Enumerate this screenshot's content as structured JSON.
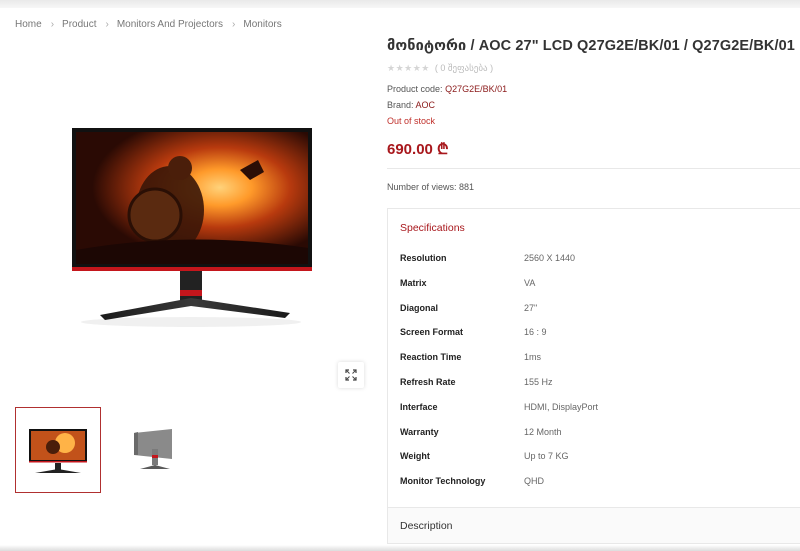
{
  "breadcrumb": [
    "Home",
    "Product",
    "Monitors And Projectors",
    "Monitors"
  ],
  "product": {
    "title": "მონიტორი / AOC 27\" LCD Q27G2E/BK/01 / Q27G2E/BK/01",
    "rating_stars": "★★★★★",
    "rating_text": "( 0 შეფასება )",
    "code_label": "Product code:",
    "code_value": "Q27G2E/BK/01",
    "brand_label": "Brand:",
    "brand_value": "AOC",
    "stock_status": "Out of stock",
    "price": "690.00 ₾",
    "views_label": "Number of views:",
    "views_value": "881"
  },
  "gallery": {
    "main_image": "aoc-monitor-front",
    "thumbnails": [
      "aoc-monitor-front",
      "aoc-monitor-back"
    ],
    "zoom_icon": "expand-icon"
  },
  "specifications": {
    "title": "Specifications",
    "rows": [
      {
        "name": "Resolution",
        "value": "2560 X 1440"
      },
      {
        "name": "Matrix",
        "value": "VA"
      },
      {
        "name": "Diagonal",
        "value": "27\""
      },
      {
        "name": "Screen Format",
        "value": "16 : 9"
      },
      {
        "name": "Reaction Time",
        "value": "1ms"
      },
      {
        "name": "Refresh Rate",
        "value": "155 Hz"
      },
      {
        "name": "Interface",
        "value": "HDMI, DisplayPort"
      },
      {
        "name": "Warranty",
        "value": "12 Month"
      },
      {
        "name": "Weight",
        "value": "Up to 7 KG"
      },
      {
        "name": "Monitor Technology",
        "value": "QHD"
      }
    ]
  },
  "description": {
    "title": "Description"
  },
  "colors": {
    "accent": "#a8171c",
    "stock": "#c0302b",
    "link": "#8b1a1a"
  }
}
